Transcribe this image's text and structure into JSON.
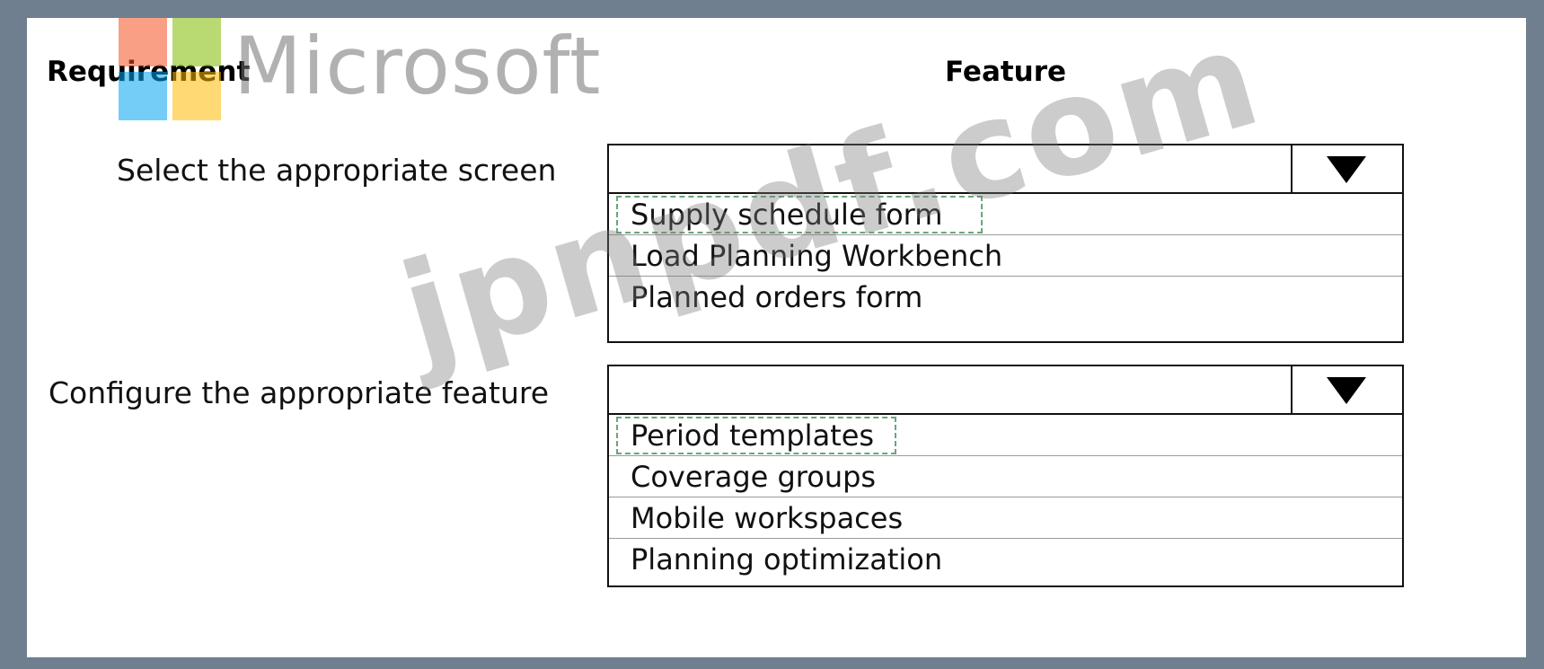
{
  "headers": {
    "requirement": "Requirement",
    "feature": "Feature"
  },
  "logo": {
    "text": "Microsoft",
    "colors": [
      "#f25022",
      "#7fba00",
      "#00a4ef",
      "#ffb900"
    ]
  },
  "rows": [
    {
      "requirement": "Select the appropriate screen",
      "selected": "",
      "options": [
        "Supply schedule form",
        "Load Planning Workbench",
        "Planned orders form"
      ]
    },
    {
      "requirement": "Configure the appropriate feature",
      "selected": "",
      "options": [
        "Period templates",
        "Coverage groups",
        "Mobile workspaces",
        "Planning optimization"
      ]
    }
  ],
  "watermark": "jpnpdf.com"
}
